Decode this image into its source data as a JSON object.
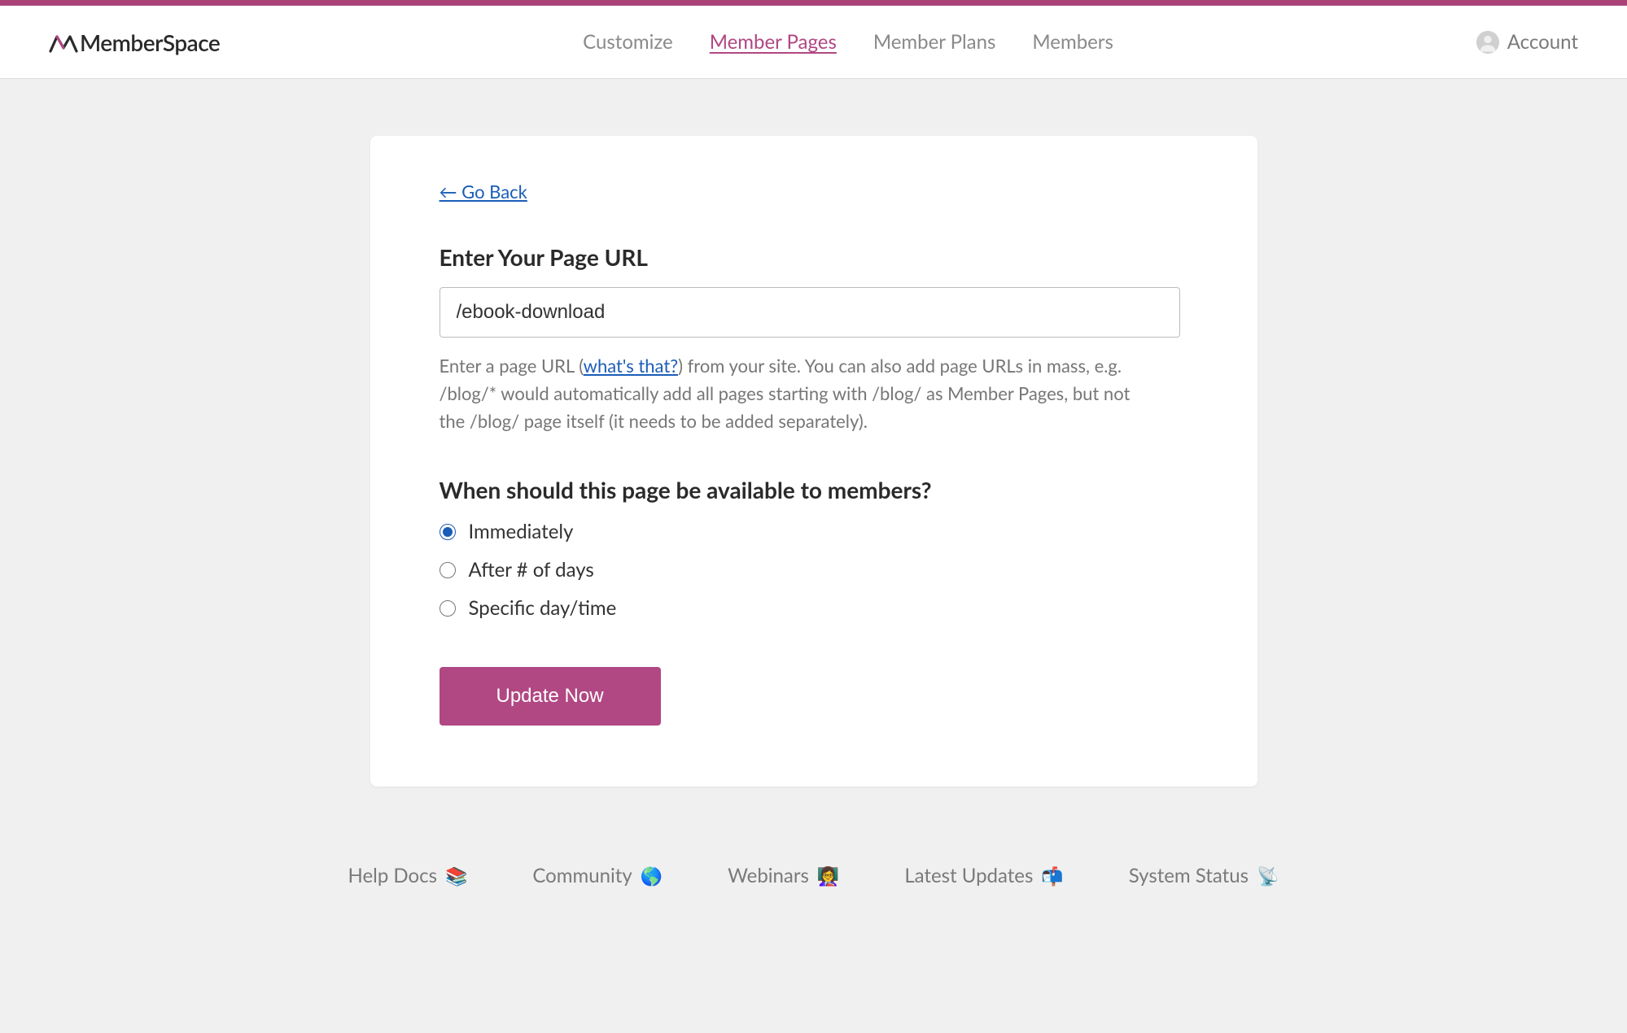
{
  "brand": {
    "name": "MemberSpace"
  },
  "nav": {
    "items": [
      {
        "label": "Customize",
        "active": false
      },
      {
        "label": "Member Pages",
        "active": true
      },
      {
        "label": "Member Plans",
        "active": false
      },
      {
        "label": "Members",
        "active": false
      }
    ]
  },
  "account": {
    "label": "Account"
  },
  "form": {
    "go_back": "← Go Back",
    "url_title": "Enter Your Page URL",
    "url_value": "/ebook-download",
    "helper_prefix": "Enter a page URL (",
    "helper_link": "what's that?",
    "helper_suffix": ") from your site. You can also add page URLs in mass, e.g. /blog/* would automatically add all pages starting with /blog/ as Member Pages, but not the /blog/ page itself (it needs to be added separately).",
    "availability_title": "When should this page be available to members?",
    "availability_options": [
      {
        "label": "Immediately",
        "checked": true
      },
      {
        "label": "After # of days",
        "checked": false
      },
      {
        "label": "Specific day/time",
        "checked": false
      }
    ],
    "submit_label": "Update Now"
  },
  "footer": {
    "items": [
      {
        "label": "Help Docs",
        "emoji": "📚"
      },
      {
        "label": "Community",
        "emoji": "🌎"
      },
      {
        "label": "Webinars",
        "emoji": "👩‍🏫"
      },
      {
        "label": "Latest Updates",
        "emoji": "📬"
      },
      {
        "label": "System Status",
        "emoji": "📡"
      }
    ]
  }
}
